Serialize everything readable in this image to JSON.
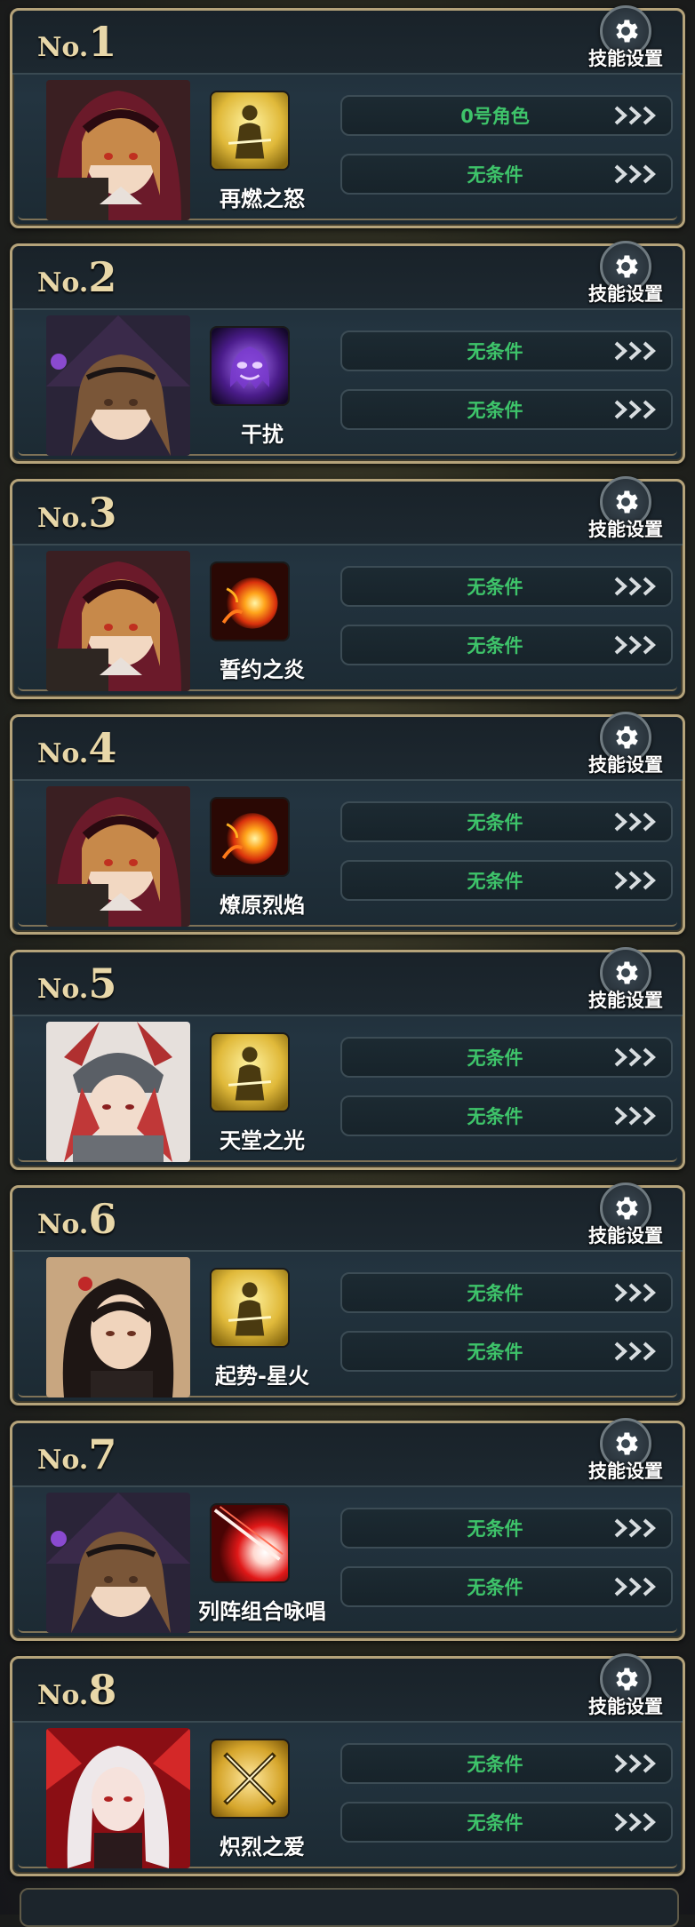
{
  "gear_label": "技能设置",
  "no_prefix": "No.",
  "colors": {
    "condition_text": "#3ec46a",
    "frame_gold": "#b5a37a",
    "number_gold": "#e8d7a8"
  },
  "slots": [
    {
      "no": "1",
      "character": "red-hood-girl",
      "skill": {
        "name": "再燃之怒",
        "icon": "golden-warrior-icon"
      },
      "conditions": [
        "0号角色",
        "无条件"
      ]
    },
    {
      "no": "2",
      "character": "witch-girl",
      "skill": {
        "name": "干扰",
        "icon": "purple-ghost-icon"
      },
      "conditions": [
        "无条件",
        "无条件"
      ]
    },
    {
      "no": "3",
      "character": "red-hood-girl",
      "skill": {
        "name": "誓约之炎",
        "icon": "fireball-icon"
      },
      "conditions": [
        "无条件",
        "无条件"
      ]
    },
    {
      "no": "4",
      "character": "red-hood-girl",
      "skill": {
        "name": "燎原烈焰",
        "icon": "fireball-icon"
      },
      "conditions": [
        "无条件",
        "无条件"
      ]
    },
    {
      "no": "5",
      "character": "armored-knight",
      "skill": {
        "name": "天堂之光",
        "icon": "golden-warrior-icon"
      },
      "conditions": [
        "无条件",
        "无条件"
      ]
    },
    {
      "no": "6",
      "character": "black-hair-girl",
      "skill": {
        "name": "起势-星火",
        "icon": "golden-warrior-icon"
      },
      "conditions": [
        "无条件",
        "无条件"
      ]
    },
    {
      "no": "7",
      "character": "witch-girl",
      "skill": {
        "name": "列阵组合咏唱",
        "icon": "red-burst-icon"
      },
      "conditions": [
        "无条件",
        "无条件"
      ]
    },
    {
      "no": "8",
      "character": "white-hair-girl",
      "skill": {
        "name": "炽烈之爱",
        "icon": "crossed-swords-icon"
      },
      "conditions": [
        "无条件",
        "无条件"
      ]
    }
  ]
}
